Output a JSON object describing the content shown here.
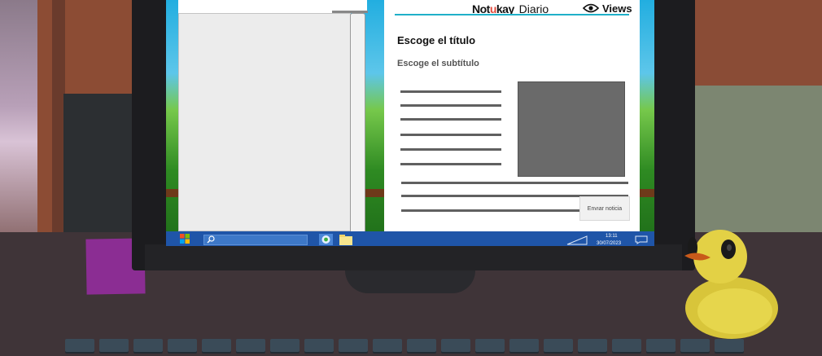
{
  "news_app": {
    "brand_part1": "Not",
    "brand_accent": "u",
    "brand_part2": "kay",
    "brand_suffix": "Diario",
    "views_label": "Views",
    "title_placeholder": "Escoge el título",
    "subtitle_placeholder": "Escoge el subtítulo",
    "send_button": "Envıar noticia",
    "accent_color": "#1fb0c9"
  },
  "taskbar": {
    "time": "13:11",
    "date": "30/07/2023",
    "icons": [
      "windows-start-icon",
      "search-icon",
      "app-icon",
      "folder-icon",
      "network-icon",
      "notification-icon"
    ]
  },
  "scene": {
    "objects": [
      "monitor",
      "sticky-note",
      "rubber-duck",
      "keyboard"
    ]
  }
}
